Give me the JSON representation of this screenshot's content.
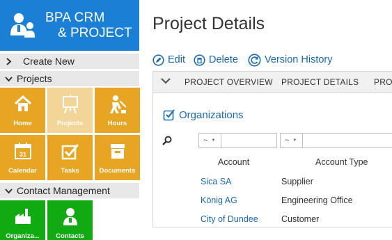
{
  "brand": {
    "line1": "BPA CRM",
    "line2": "& PROJECT",
    "color": "#1b7fd6"
  },
  "sidebar": {
    "create_new": "Create New",
    "projects_header": "Projects",
    "contact_header": "Contact Management",
    "project_tiles": [
      {
        "label": "Home",
        "icon": "home-icon"
      },
      {
        "label": "Projects",
        "icon": "easel-icon"
      },
      {
        "label": "Hours",
        "icon": "worker-icon"
      },
      {
        "label": "Calendar",
        "icon": "calendar-icon"
      },
      {
        "label": "Tasks",
        "icon": "checkbox-icon"
      },
      {
        "label": "Documents",
        "icon": "file-box-icon"
      }
    ],
    "contact_tiles": [
      {
        "label": "Organiza...",
        "icon": "factory-icon"
      },
      {
        "label": "Contacts",
        "icon": "person-icon"
      }
    ],
    "tile_color": "#e8a524",
    "active_tile_color": "#f4d599",
    "contact_tile_color": "#12aa12"
  },
  "main": {
    "title": "Project Details",
    "commands": {
      "edit": "Edit",
      "delete": "Delete",
      "history": "Version History"
    },
    "tabs": [
      "PROJECT OVERVIEW",
      "PROJECT DETAILS",
      "PROJE"
    ],
    "section_title": "Organizations",
    "filters": [
      {
        "operator": "~",
        "value": ""
      },
      {
        "operator": "~",
        "value": ""
      }
    ],
    "columns": [
      "Account",
      "Account Type"
    ],
    "rows": [
      {
        "account": "Sica SA",
        "type": "Supplier"
      },
      {
        "account": "König AG",
        "type": "Engineering Office"
      },
      {
        "account": "City of Dundee",
        "type": "Customer"
      }
    ],
    "link_color": "#1a6ab0"
  }
}
